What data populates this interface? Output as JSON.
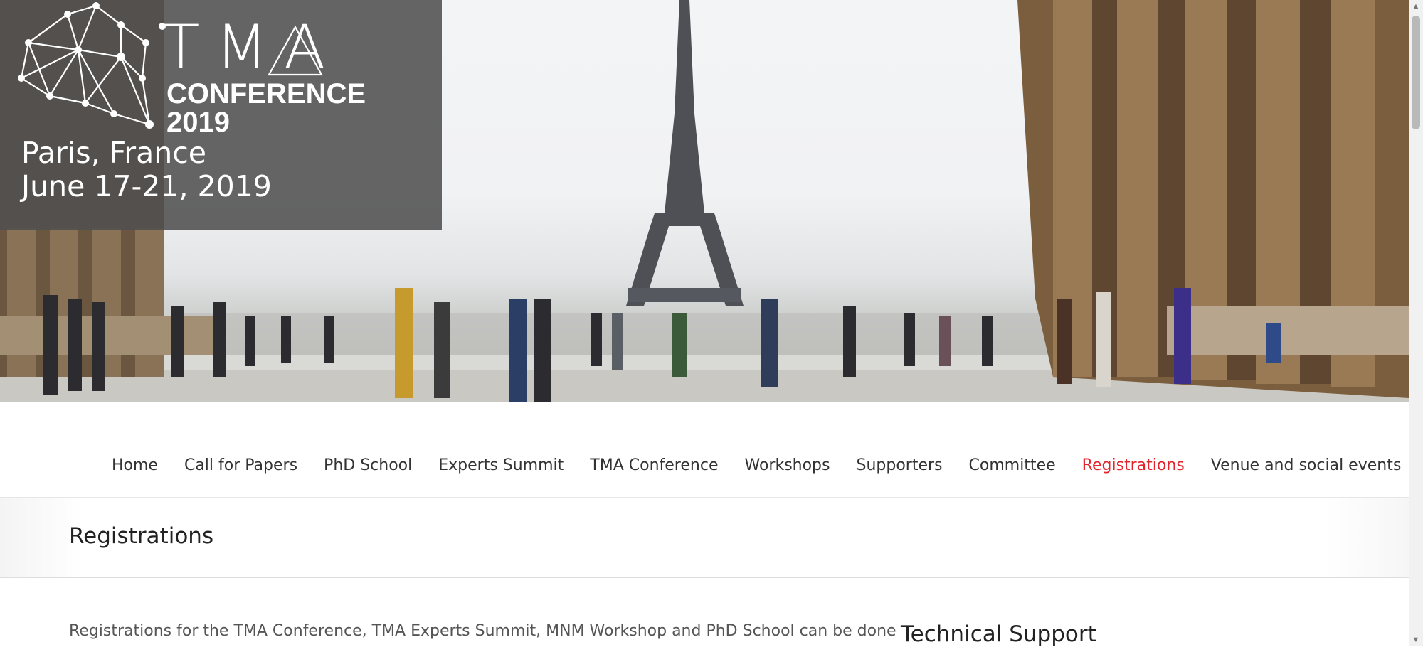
{
  "hero": {
    "logo_tma": "TMA",
    "logo_conference": "CONFERENCE",
    "logo_year": "2019",
    "city": "Paris, France",
    "dates": "June 17-21, 2019"
  },
  "nav": {
    "items": [
      {
        "label": "Home"
      },
      {
        "label": "Call for Papers"
      },
      {
        "label": "PhD School"
      },
      {
        "label": "Experts Summit"
      },
      {
        "label": "TMA Conference"
      },
      {
        "label": "Workshops"
      },
      {
        "label": "Supporters"
      },
      {
        "label": "Committee"
      },
      {
        "label": "Registrations",
        "active": true
      },
      {
        "label": "Venue and social events"
      }
    ]
  },
  "page": {
    "title": "Registrations",
    "intro": "Registrations for the TMA Conference, TMA Experts Summit, MNM Workshop and PhD School can be done"
  },
  "sidebar": {
    "heading": "Technical Support"
  },
  "colors": {
    "accent": "#e3242b",
    "logo_overlay": "#505050"
  }
}
